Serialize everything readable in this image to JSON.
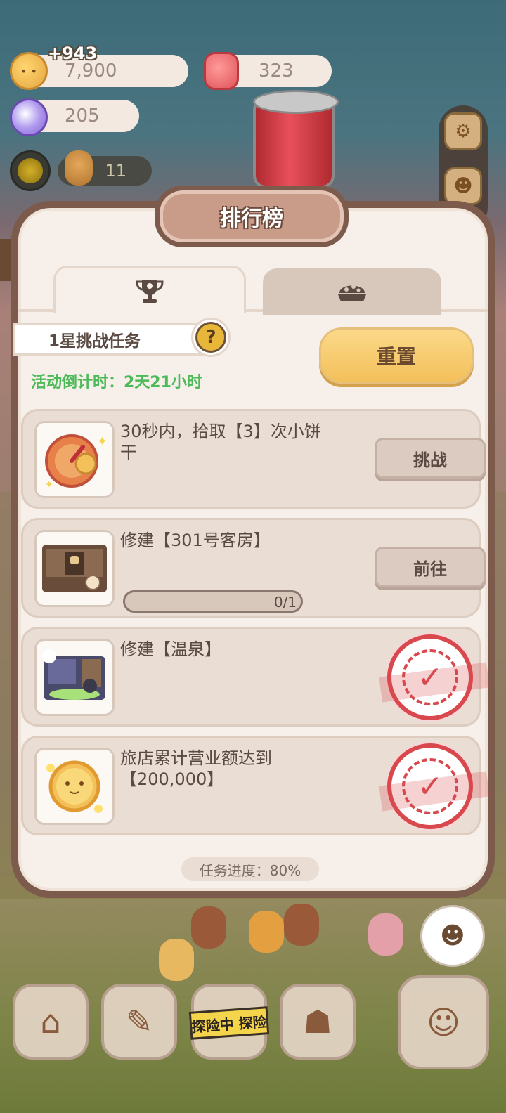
{
  "hud": {
    "coins": "7,900",
    "coin_bonus": "+943",
    "candies": "323",
    "gems": "205",
    "workers": "11"
  },
  "dialog": {
    "title": "排行榜",
    "tabs": [
      {
        "icon": "trophy-icon",
        "active": true
      },
      {
        "icon": "cookie-icon",
        "active": false
      }
    ],
    "task_group_title": "1星挑战任务",
    "help_symbol": "?",
    "countdown": "活动倒计时：2天21小时",
    "reset_label": "重置",
    "tasks": [
      {
        "text": "30秒内，拾取【3】次小饼干",
        "action": "挑战",
        "status": "action"
      },
      {
        "text": "修建【301号客房】",
        "action": "前往",
        "status": "action",
        "progress_text": "0/1",
        "progress": 0
      },
      {
        "text": "修建【温泉】",
        "status": "done"
      },
      {
        "text": "旅店累计营业额达到【200,000】",
        "status": "done"
      }
    ],
    "overall_progress": "任务进度：80%"
  },
  "bottom_bar": {
    "explore_tag": "探险中 探险"
  },
  "colors": {
    "dialog_border": "#7c5a4c",
    "countdown_green": "#4cba58",
    "reset_yellow": "#f3c05a",
    "stamp_red": "#d8484c"
  }
}
